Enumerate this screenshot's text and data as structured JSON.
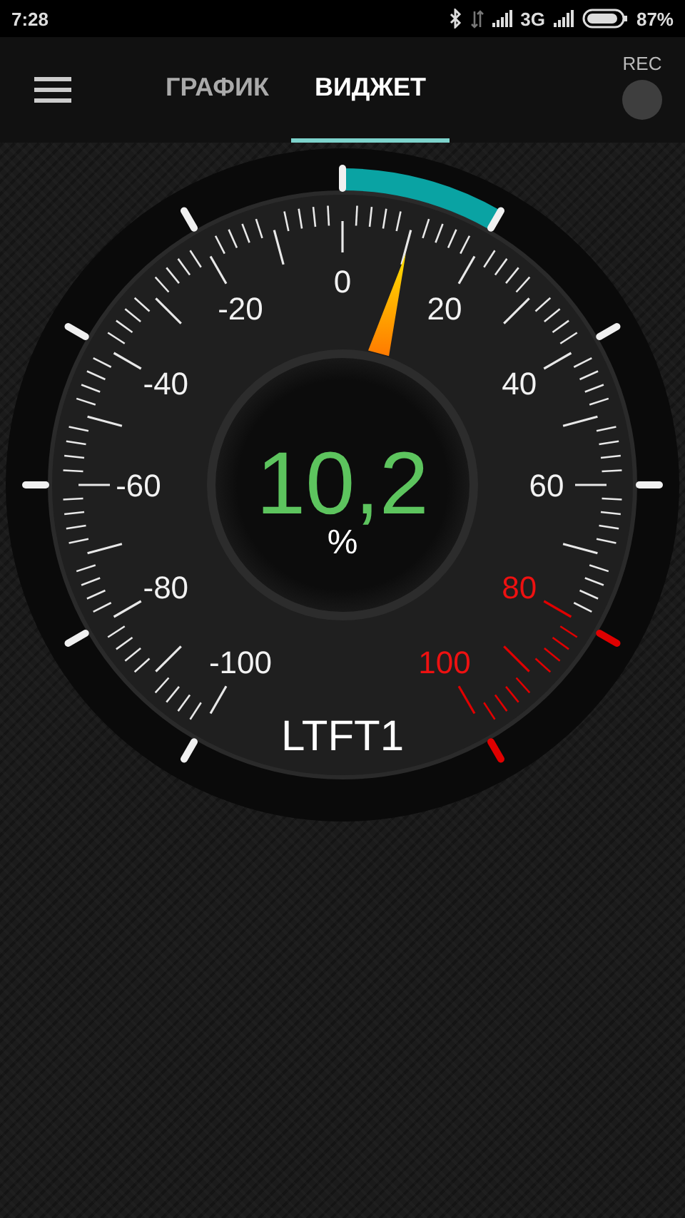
{
  "status_bar": {
    "time": "7:28",
    "network": "3G",
    "battery": "87%"
  },
  "tabs": [
    {
      "label": "ГРАФИК",
      "selected": false
    },
    {
      "label": "ВИДЖЕТ",
      "selected": true
    }
  ],
  "rec": {
    "label": "REC",
    "recording": false
  },
  "gauge": {
    "value": "10,2",
    "unit": "%",
    "sensor": "LTFT1",
    "scale_labels": [
      {
        "text": "-100",
        "warning": false
      },
      {
        "text": "-80",
        "warning": false
      },
      {
        "text": "-60",
        "warning": false
      },
      {
        "text": "-40",
        "warning": false
      },
      {
        "text": "-20",
        "warning": false
      },
      {
        "text": "0",
        "warning": false
      },
      {
        "text": "20",
        "warning": false
      },
      {
        "text": "40",
        "warning": false
      },
      {
        "text": "60",
        "warning": false
      },
      {
        "text": "80",
        "warning": true
      },
      {
        "text": "100",
        "warning": true
      }
    ]
  }
}
